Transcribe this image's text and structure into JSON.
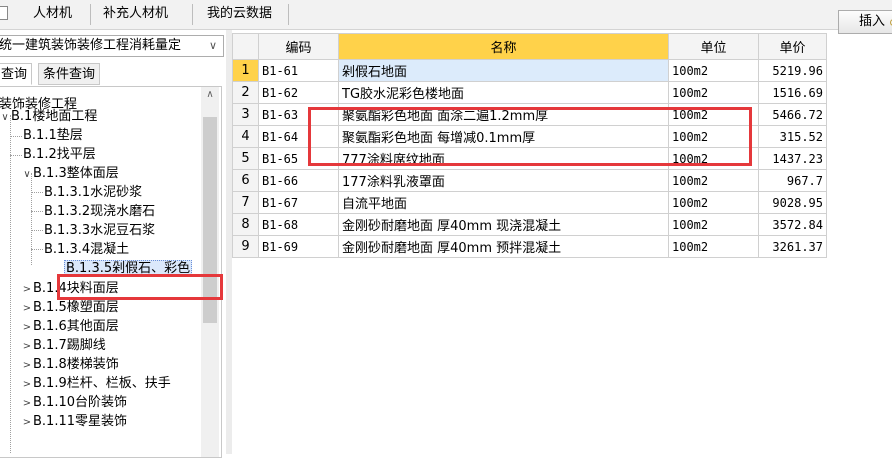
{
  "toolbar": {
    "tabs": [
      "人材机",
      "补充人材机",
      "我的云数据"
    ],
    "insert_label": "插入"
  },
  "left_panel": {
    "library": "统一建筑装饰装修工程消耗量定",
    "query_tabs": [
      "查询",
      "条件查询"
    ],
    "tree": [
      {
        "label": "装饰装修工程",
        "level": 0,
        "toggle": ""
      },
      {
        "label": "B.1楼地面工程",
        "level": 1,
        "toggle": "v"
      },
      {
        "label": "B.1.1垫层",
        "level": 2,
        "toggle": ""
      },
      {
        "label": "B.1.2找平层",
        "level": 2,
        "toggle": ""
      },
      {
        "label": "B.1.3整体面层",
        "level": 2,
        "toggle": "v"
      },
      {
        "label": "B.1.3.1水泥砂浆",
        "level": 3,
        "toggle": ""
      },
      {
        "label": "B.1.3.2现浇水磨石",
        "level": 3,
        "toggle": ""
      },
      {
        "label": "B.1.3.3水泥豆石浆",
        "level": 3,
        "toggle": ""
      },
      {
        "label": "B.1.3.4混凝土",
        "level": 3,
        "toggle": ""
      },
      {
        "label": "B.1.3.5剁假石、彩色",
        "level": 3,
        "toggle": "",
        "selected": true
      },
      {
        "label": "B.1.4块料面层",
        "level": 2,
        "toggle": ">"
      },
      {
        "label": "B.1.5橡塑面层",
        "level": 2,
        "toggle": ">"
      },
      {
        "label": "B.1.6其他面层",
        "level": 2,
        "toggle": ">"
      },
      {
        "label": "B.1.7踢脚线",
        "level": 2,
        "toggle": ">"
      },
      {
        "label": "B.1.8楼梯装饰",
        "level": 2,
        "toggle": ">"
      },
      {
        "label": "B.1.9栏杆、栏板、扶手",
        "level": 2,
        "toggle": ">"
      },
      {
        "label": "B.1.10台阶装饰",
        "level": 2,
        "toggle": ">"
      },
      {
        "label": "B.1.11零星装饰",
        "level": 2,
        "toggle": ">"
      }
    ]
  },
  "grid": {
    "columns": [
      "编码",
      "名称",
      "单位",
      "单价"
    ],
    "rows": [
      {
        "no": "1",
        "code": "B1-61",
        "name": "剁假石地面",
        "unit": "100m2",
        "price": "5219.96"
      },
      {
        "no": "2",
        "code": "B1-62",
        "name": "TG胶水泥彩色楼地面",
        "unit": "100m2",
        "price": "1516.69"
      },
      {
        "no": "3",
        "code": "B1-63",
        "name": "聚氨酯彩色地面 面涂二遍1.2mm厚",
        "unit": "100m2",
        "price": "5466.72"
      },
      {
        "no": "4",
        "code": "B1-64",
        "name": "聚氨酯彩色地面 每增减0.1mm厚",
        "unit": "100m2",
        "price": "315.52"
      },
      {
        "no": "5",
        "code": "B1-65",
        "name": "777涂料席纹地面",
        "unit": "100m2",
        "price": "1437.23"
      },
      {
        "no": "6",
        "code": "B1-66",
        "name": "177涂料乳液罩面",
        "unit": "100m2",
        "price": "967.7"
      },
      {
        "no": "7",
        "code": "B1-67",
        "name": "自流平地面",
        "unit": "100m2",
        "price": "9028.95"
      },
      {
        "no": "8",
        "code": "B1-68",
        "name": "金刚砂耐磨地面 厚40mm 现浇混凝土",
        "unit": "100m2",
        "price": "3572.84"
      },
      {
        "no": "9",
        "code": "B1-69",
        "name": "金刚砂耐磨地面 厚40mm 预拌混凝土",
        "unit": "100m2",
        "price": "3261.37"
      }
    ]
  },
  "colors": {
    "highlight": "#e5383b",
    "header_name": "#ffd24a",
    "selected_row": "#dcebfb"
  },
  "icons": {
    "dropdown": "chevron-down-icon",
    "scroll_up": "scroll-up-arrow-icon"
  }
}
